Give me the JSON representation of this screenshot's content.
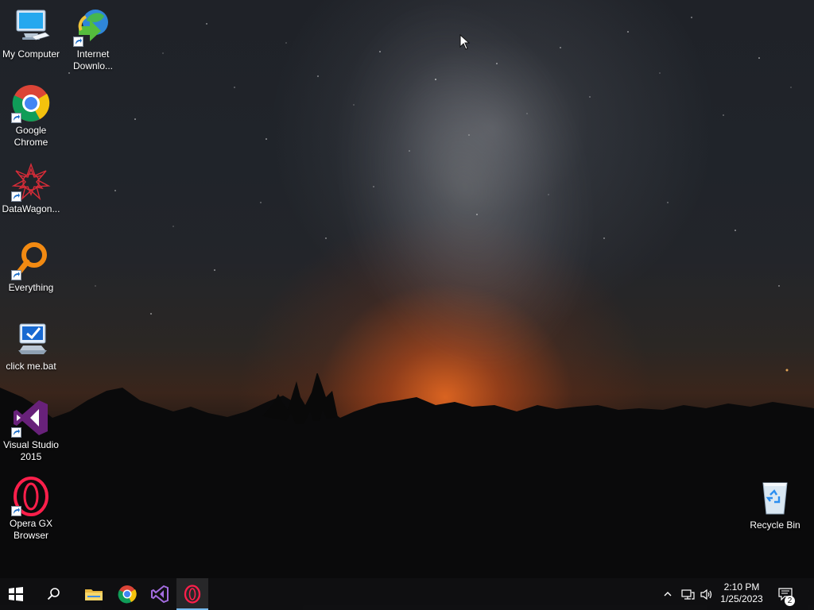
{
  "desktop": {
    "icons": [
      {
        "name": "my-computer",
        "label": "My Computer",
        "icon": "computer-icon"
      },
      {
        "name": "internet-download-manager",
        "label": "Internet Downlo...",
        "icon": "download-manager-icon"
      },
      {
        "name": "google-chrome",
        "label": "Google Chrome",
        "icon": "chrome-icon"
      },
      {
        "name": "datawagon",
        "label": "DataWagon...",
        "icon": "datawagon-icon"
      },
      {
        "name": "everything",
        "label": "Everything",
        "icon": "magnifier-icon"
      },
      {
        "name": "click-me-bat",
        "label": "click me.bat",
        "icon": "batch-file-icon"
      },
      {
        "name": "visual-studio-2015",
        "label": "Visual Studio 2015",
        "icon": "visual-studio-icon"
      },
      {
        "name": "opera-gx-browser",
        "label": "Opera GX Browser",
        "icon": "opera-gx-icon"
      },
      {
        "name": "recycle-bin",
        "label": "Recycle Bin",
        "icon": "recycle-bin-icon"
      }
    ]
  },
  "taskbar": {
    "pinned": [
      {
        "name": "start",
        "icon": "windows-logo-icon"
      },
      {
        "name": "search",
        "icon": "search-icon"
      },
      {
        "name": "file-explorer",
        "icon": "folder-icon"
      },
      {
        "name": "chrome",
        "icon": "chrome-icon"
      },
      {
        "name": "visual-studio",
        "icon": "visual-studio-icon"
      },
      {
        "name": "opera-gx",
        "icon": "opera-gx-icon",
        "active": true
      }
    ],
    "tray": {
      "clock": {
        "time": "2:10 PM",
        "date": "1/25/2023"
      },
      "notification_count": "2"
    }
  }
}
